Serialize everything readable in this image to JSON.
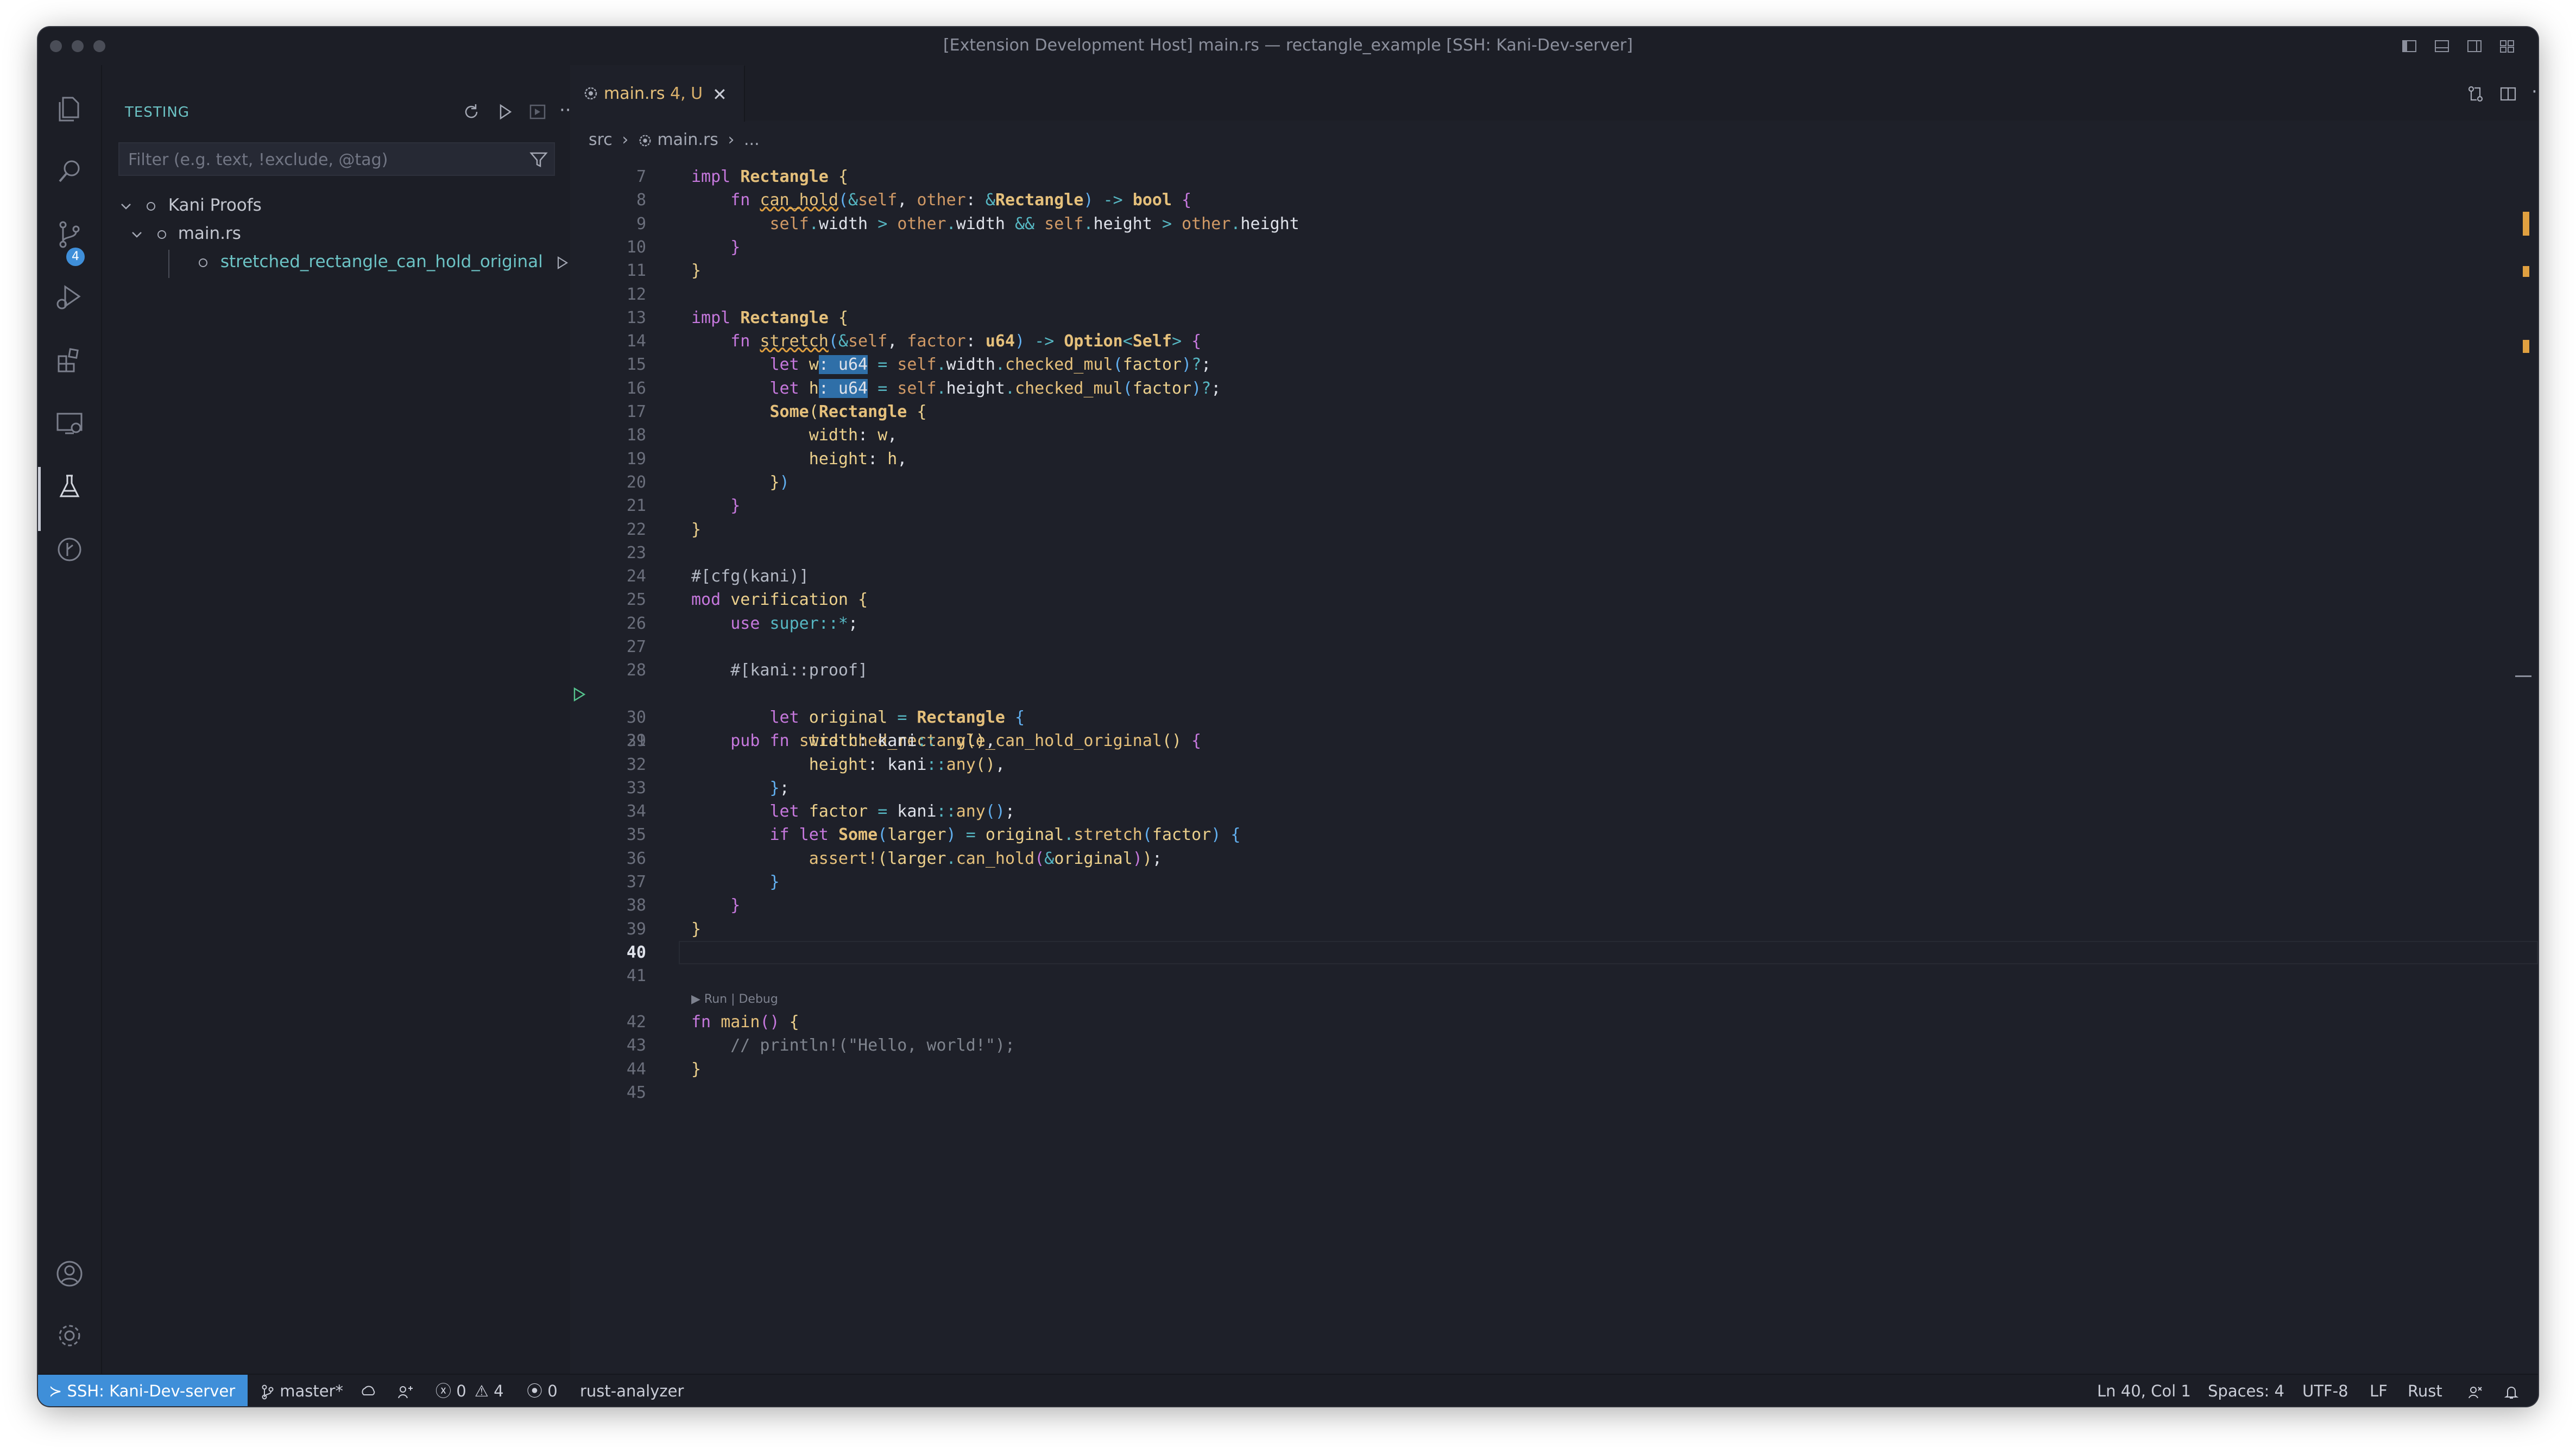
{
  "window": {
    "title": "[Extension Development Host] main.rs — rectangle_example [SSH: Kani-Dev-server]"
  },
  "activity_bar": {
    "items": [
      {
        "name": "explorer-icon"
      },
      {
        "name": "search-icon"
      },
      {
        "name": "source-control-icon",
        "badge": "4"
      },
      {
        "name": "run-debug-icon"
      },
      {
        "name": "extensions-icon"
      },
      {
        "name": "remote-explorer-icon"
      },
      {
        "name": "testing-flask-icon",
        "active": true
      },
      {
        "name": "git-graph-icon"
      }
    ],
    "bottom": [
      {
        "name": "account-icon"
      },
      {
        "name": "manage-gear-icon"
      }
    ]
  },
  "sidebar": {
    "title": "TESTING",
    "filter_placeholder": "Filter (e.g. text, !exclude, @tag)",
    "tree": {
      "root": "Kani Proofs",
      "file": "main.rs",
      "test": "stretched_rectangle_can_hold_original"
    }
  },
  "editor": {
    "tab": {
      "filename": "main.rs",
      "status": "4, U"
    },
    "breadcrumb": {
      "folder": "src",
      "file": "main.rs",
      "more": "..."
    },
    "code_lens": "▶ Run | Debug",
    "current_line": 40,
    "line_numbers": [
      "7",
      "8",
      "9",
      "10",
      "11",
      "12",
      "13",
      "14",
      "15",
      "16",
      "17",
      "18",
      "19",
      "20",
      "21",
      "22",
      "23",
      "24",
      "25",
      "26",
      "27",
      "28",
      "29",
      "30",
      "31",
      "32",
      "33",
      "34",
      "35",
      "36",
      "37",
      "38",
      "39",
      "40",
      "41",
      "42",
      "43",
      "44",
      "45"
    ]
  },
  "status_bar": {
    "remote": "SSH: Kani-Dev-server",
    "branch": "master*",
    "errors": "0",
    "warnings": "4",
    "ports": "0",
    "language_server": "rust-analyzer",
    "cursor": "Ln 40, Col 1",
    "spaces": "Spaces: 4",
    "encoding": "UTF-8",
    "eol": "LF",
    "language": "Rust"
  }
}
